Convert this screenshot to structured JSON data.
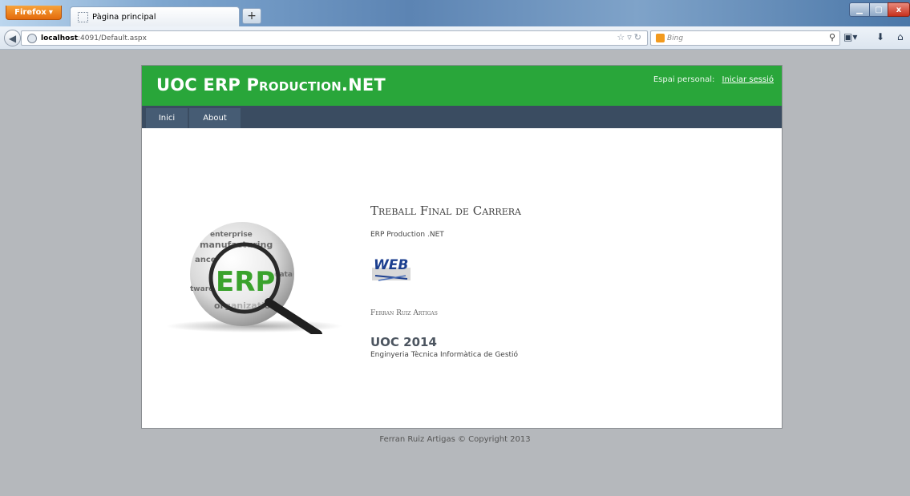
{
  "browser": {
    "menu_label": "Firefox",
    "tab_title": "Pàgina principal",
    "new_tab_label": "+",
    "url_host": "localhost",
    "url_path": ":4091/Default.aspx",
    "search_placeholder": "Bing",
    "window_buttons": {
      "minimize": "▁",
      "maximize": "▢",
      "close": "x"
    }
  },
  "site": {
    "title": "UOC ERP Production.NET",
    "login_prompt": "Espai personal:",
    "login_link": "Iniciar sessió",
    "menu": [
      {
        "label": "Inici"
      },
      {
        "label": "About"
      }
    ]
  },
  "content": {
    "title": "Treball Final de Carrera",
    "subtitle": "ERP Production .NET",
    "author": "Ferran Ruiz Artigas",
    "year": "UOC 2014",
    "degree": "Enginyeria Tècnica Informàtica de Gestió"
  },
  "art": {
    "logo_text": "ERP",
    "web_logo_text": "WEB"
  },
  "footer": {
    "text": "Ferran Ruiz Artigas © Copyright 2013"
  }
}
